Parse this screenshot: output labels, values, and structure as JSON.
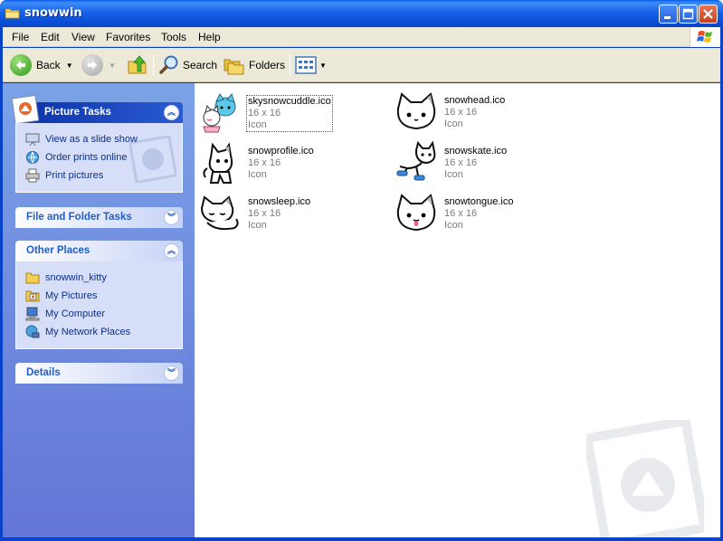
{
  "window": {
    "title": "snowwin",
    "controls": [
      "minimize",
      "maximize",
      "close"
    ],
    "colors": {
      "titlebar": "#0a5fe8",
      "taskpane": "#6375d6",
      "link": "#0c2f8a"
    }
  },
  "menu": [
    "File",
    "Edit",
    "View",
    "Favorites",
    "Tools",
    "Help"
  ],
  "toolbar": {
    "back_label": "Back",
    "search_label": "Search",
    "folders_label": "Folders"
  },
  "taskpane": {
    "picture_tasks": {
      "title": "Picture Tasks",
      "links": [
        "View as a slide show",
        "Order prints online",
        "Print pictures"
      ]
    },
    "file_folder_tasks": {
      "title": "File and Folder Tasks"
    },
    "other_places": {
      "title": "Other Places",
      "links": [
        "snowwin_kitty",
        "My Pictures",
        "My Computer",
        "My Network Places"
      ]
    },
    "details": {
      "title": "Details"
    }
  },
  "files": [
    {
      "name": "skysnowcuddle.ico",
      "dims": "16 x 16",
      "type": "Icon",
      "icon": "cuddle-kitten-icon",
      "selected": true
    },
    {
      "name": "snowhead.ico",
      "dims": "16 x 16",
      "type": "Icon",
      "icon": "cat-head-icon"
    },
    {
      "name": "snowprofile.ico",
      "dims": "16 x 16",
      "type": "Icon",
      "icon": "cat-profile-icon"
    },
    {
      "name": "snowskate.ico",
      "dims": "16 x 16",
      "type": "Icon",
      "icon": "cat-skating-icon"
    },
    {
      "name": "snowsleep.ico",
      "dims": "16 x 16",
      "type": "Icon",
      "icon": "cat-sleeping-icon"
    },
    {
      "name": "snowtongue.ico",
      "dims": "16 x 16",
      "type": "Icon",
      "icon": "cat-tongue-icon"
    }
  ]
}
